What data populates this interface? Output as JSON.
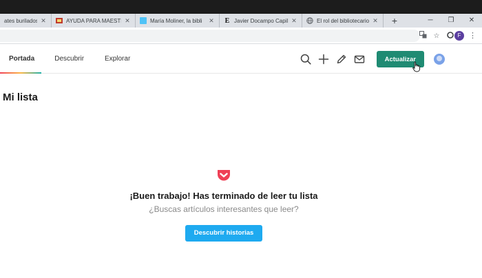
{
  "browser": {
    "tabs": [
      {
        "title": "ates burilados de",
        "favicon": "doc-icon"
      },
      {
        "title": "AYUDA PARA MAESTRO",
        "favicon": "site-icon"
      },
      {
        "title": "María Moliner, la bibli",
        "favicon": "page-icon"
      },
      {
        "title": "Javier Docampo Capilla",
        "favicon": "e-icon"
      },
      {
        "title": "El rol del bibliotecario e",
        "favicon": "globe-icon"
      }
    ],
    "new_tab": "+",
    "profile_initial": "F"
  },
  "app": {
    "nav": [
      {
        "label": "Portada",
        "active": true
      },
      {
        "label": "Descubrir",
        "active": false
      },
      {
        "label": "Explorar",
        "active": false
      }
    ],
    "update_label": "Actualizar",
    "accent": "#1f8b73"
  },
  "main": {
    "title": "Mi lista",
    "empty_title": "¡Buen trabajo! Has terminado de leer tu lista",
    "empty_subtitle": "¿Buscas artículos interesantes que leer?",
    "discover_label": "Descubrir historias",
    "discover_color": "#1eaaf0",
    "logo_color": "#ef4056"
  }
}
